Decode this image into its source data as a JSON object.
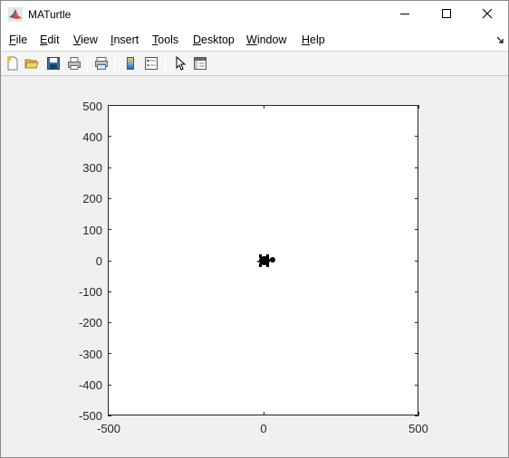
{
  "window": {
    "title": "MATurtle",
    "icons": {
      "app": "matlab-logo-icon",
      "minimize": "minimize-icon",
      "maximize": "maximize-icon",
      "close": "close-icon"
    }
  },
  "menubar": {
    "items": [
      {
        "label_mn": "F",
        "label_rest": "ile"
      },
      {
        "label_mn": "E",
        "label_rest": "dit"
      },
      {
        "label_mn": "V",
        "label_rest": "iew"
      },
      {
        "label_mn": "I",
        "label_rest": "nsert"
      },
      {
        "label_mn": "T",
        "label_rest": "ools"
      },
      {
        "label_mn": "D",
        "label_rest": "esktop"
      },
      {
        "label_mn": "W",
        "label_rest": "indow"
      },
      {
        "label_mn": "H",
        "label_rest": "elp"
      }
    ],
    "dock_icon": "dock-arrow-icon"
  },
  "toolbar": {
    "buttons": [
      "new-figure-icon",
      "open-file-icon",
      "save-icon",
      "print-icon",
      "print-preview-icon",
      "colorbar-icon",
      "legend-icon",
      "select-arrow-icon",
      "property-editor-icon"
    ]
  },
  "axes": {
    "x_ticks": [
      "-500",
      "0",
      "500"
    ],
    "y_ticks": [
      "500",
      "400",
      "300",
      "200",
      "100",
      "0",
      "-100",
      "-200",
      "-300",
      "-400",
      "-500"
    ],
    "xlim": [
      -500,
      500
    ],
    "ylim": [
      -500,
      500
    ],
    "turtle_position": {
      "x": 0,
      "y": 0
    },
    "turtle_icon": "turtle-icon"
  },
  "colors": {
    "axes_line": "#262626",
    "figure_bg": "#f0f0f0",
    "plot_bg": "#ffffff"
  }
}
